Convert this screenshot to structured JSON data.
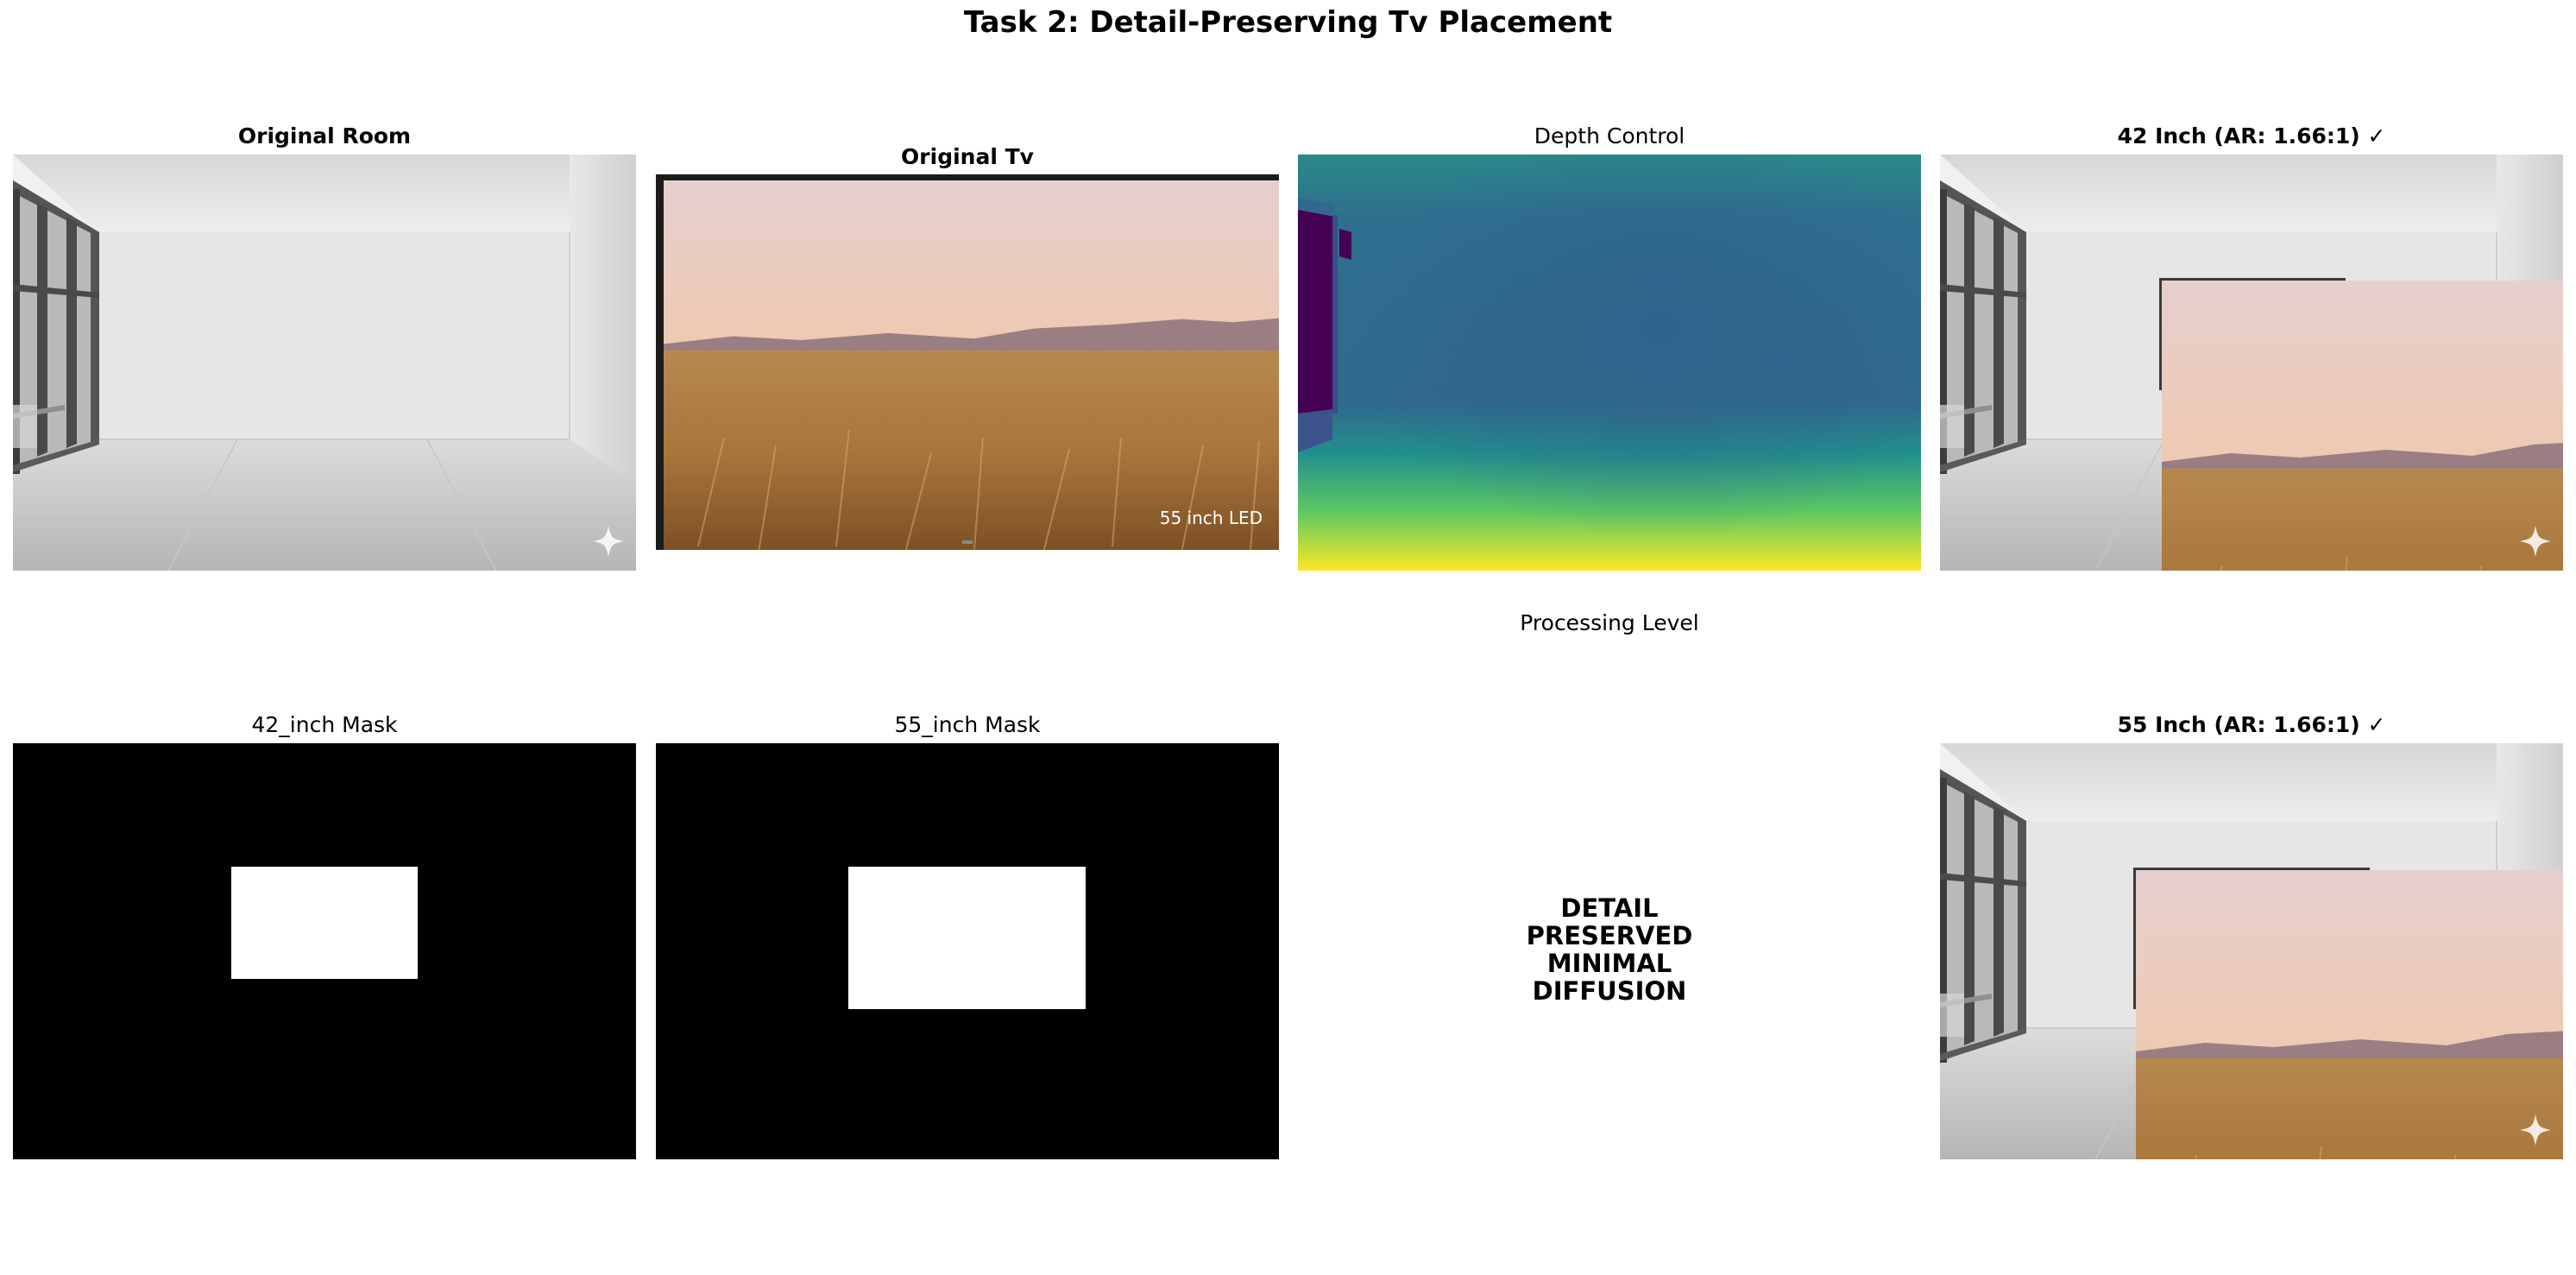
{
  "figure": {
    "title": "Task 2: Detail-Preserving Tv Placement"
  },
  "panels": {
    "original_room": {
      "title": "Original Room"
    },
    "original_tv": {
      "title": "Original Tv",
      "tv_label": "55 inch LED"
    },
    "depth_control": {
      "title": "Depth Control"
    },
    "result_42": {
      "title": "42 Inch (AR: 1.66:1) ✓"
    },
    "mask_42": {
      "title": "42_inch Mask"
    },
    "mask_55": {
      "title": "55_inch Mask"
    },
    "processing": {
      "title": "Processing Level",
      "text": "DETAIL\nPRESERVED\nMINIMAL\nDIFFUSION"
    },
    "result_55": {
      "title": "55 Inch (AR: 1.66:1) ✓"
    }
  },
  "colors": {
    "mask_bg": "#000000",
    "mask_fg": "#ffffff",
    "depth_far": "#2f6e8e",
    "depth_near": "#fde725",
    "depth_window": "#440154"
  },
  "icons": [
    "sparkle-icon"
  ]
}
